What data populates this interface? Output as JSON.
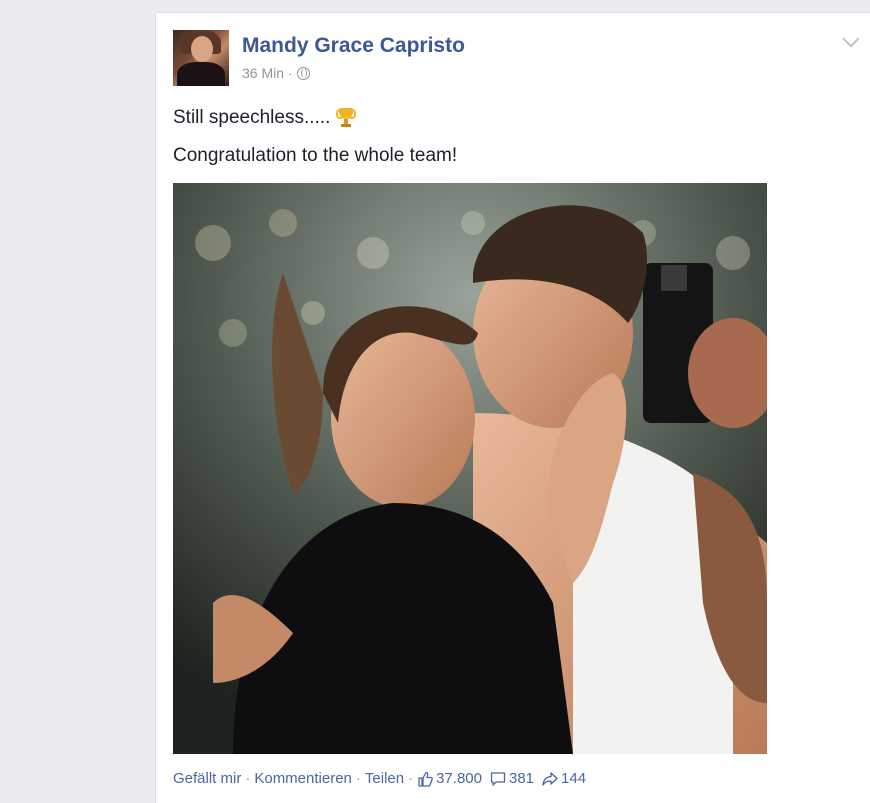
{
  "post": {
    "author_name": "Mandy Grace Capristo",
    "timestamp": "36 Min",
    "meta_separator": "·",
    "line1": "Still speechless.....",
    "line2": "Congratulation to the whole team!",
    "photo_icon": "photo-image",
    "avatar_icon": "avatar-image"
  },
  "actions": {
    "like_label": "Gefällt mir",
    "comment_label": "Kommentieren",
    "share_label": "Teilen",
    "separator": "·",
    "likes_count": "37.800",
    "comments_count": "381",
    "shares_count": "144"
  },
  "colors": {
    "link_blue": "#3b5998",
    "background": "#e9ebee",
    "card": "#ffffff",
    "meta_gray": "#90949c"
  },
  "icons": [
    "globe-icon",
    "trophy-icon",
    "chevron-down-icon",
    "thumbs-up-icon",
    "comment-icon",
    "share-icon"
  ]
}
